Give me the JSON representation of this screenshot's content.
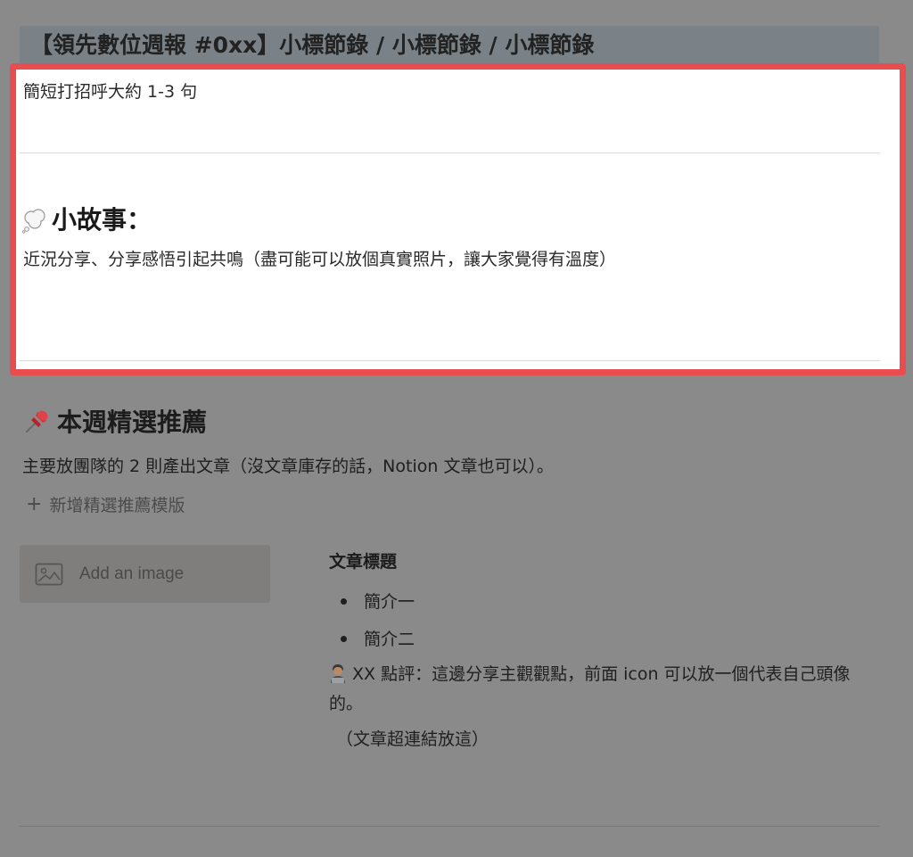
{
  "page": {
    "title": "【領先數位週報 #0xx】小標節錄 / 小標節錄 / 小標節錄"
  },
  "intro": {
    "greeting": "簡短打招呼大約 1-3 句"
  },
  "story": {
    "heading": "小故事：",
    "icon": "thought-bubble-icon",
    "body": "近況分享、分享感悟引起共鳴（盡可能可以放個真實照片，讓大家覺得有溫度）"
  },
  "featured": {
    "heading": "本週精選推薦",
    "icon": "pushpin-icon",
    "description": "主要放團隊的 2 則產出文章（沒文章庫存的話，Notion 文章也可以）。",
    "add_template_label": "新增精選推薦模版"
  },
  "image_block": {
    "label": "Add an image"
  },
  "article": {
    "title": "文章標題",
    "bullets": [
      "簡介一",
      "簡介二"
    ],
    "comment": "XX 點評：這邊分享主觀觀點，前面 icon 可以放一個代表自己頭像的。",
    "link_note": "（文章超連結放這）"
  },
  "colors": {
    "highlight_border": "#ea4d4f",
    "overlay": "#8a8a8a",
    "title_bar": "#7a8287"
  }
}
